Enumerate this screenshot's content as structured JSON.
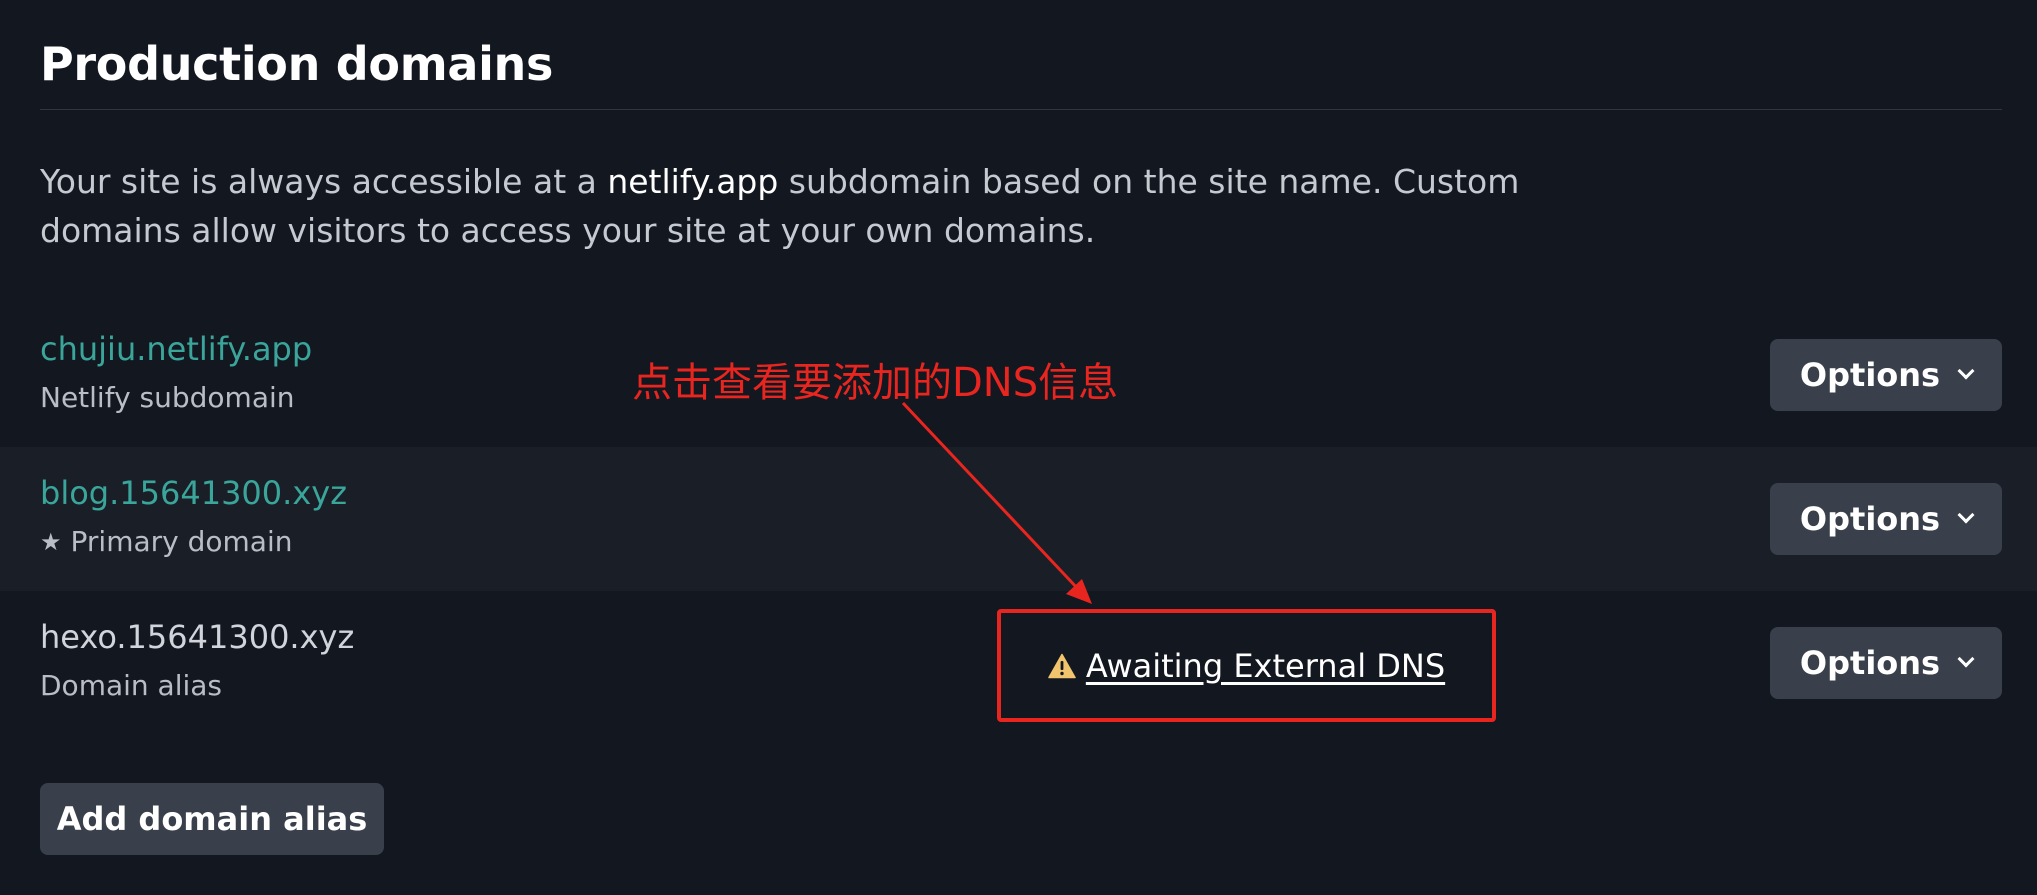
{
  "section": {
    "title": "Production domains",
    "description": {
      "before": "Your site is always accessible at a ",
      "highlight": "netlify.app",
      "after": " subdomain based on the site name. Custom domains allow visitors to access your site at your own domains."
    }
  },
  "domains": [
    {
      "name": "chujiu.netlify.app",
      "subtitle": "Netlify subdomain",
      "options_label": "Options"
    },
    {
      "name": "blog.15641300.xyz",
      "subtitle": "Primary domain",
      "options_label": "Options",
      "icon": "star-icon"
    },
    {
      "name": "hexo.15641300.xyz",
      "subtitle": "Domain alias",
      "options_label": "Options",
      "status": "Awaiting External DNS",
      "status_icon": "warning-icon"
    }
  ],
  "annotation": {
    "text": "点击查看要添加的DNS信息",
    "color": "#e8251f"
  },
  "actions": {
    "add_alias_label": "Add domain alias"
  },
  "colors": {
    "background": "#131720",
    "row_alt": "#1a1f27",
    "link": "#3aa59a",
    "button": "#3a404b",
    "warning": "#f2c46d",
    "annotation": "#e8251f"
  }
}
